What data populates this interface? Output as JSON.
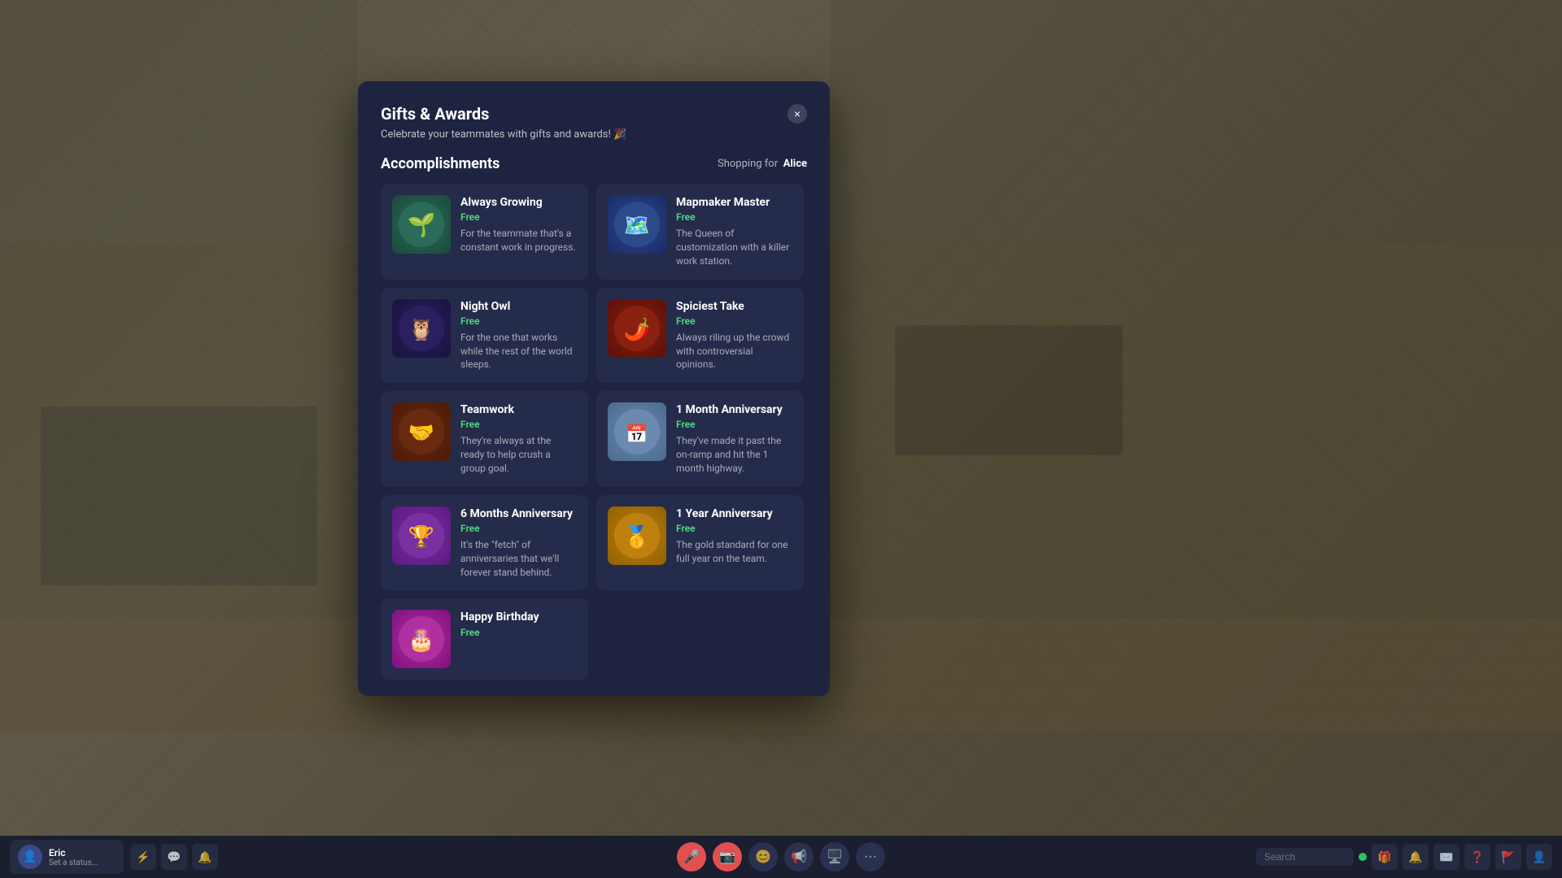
{
  "modal": {
    "title": "Gifts & Awards",
    "subtitle": "Celebrate your teammates with gifts and awards! 🎉",
    "shopping_for_label": "Shopping for",
    "shopping_for_name": "Alice",
    "section_title": "Accomplishments",
    "close_label": "×"
  },
  "awards": [
    {
      "id": "always-growing",
      "name": "Always Growing",
      "price": "Free",
      "description": "For the teammate that's a constant work in progress.",
      "icon_class": "icon-always-growing",
      "icon_emoji": "🌱"
    },
    {
      "id": "mapmaker-master",
      "name": "Mapmaker Master",
      "price": "Free",
      "description": "The Queen of customization with a killer work station.",
      "icon_class": "icon-mapmaker",
      "icon_emoji": "🗺️"
    },
    {
      "id": "night-owl",
      "name": "Night Owl",
      "price": "Free",
      "description": "For the one that works while the rest of the world sleeps.",
      "icon_class": "icon-night-owl",
      "icon_emoji": "🦉"
    },
    {
      "id": "spiciest-take",
      "name": "Spiciest Take",
      "price": "Free",
      "description": "Always riling up the crowd with controversial opinions.",
      "icon_class": "icon-spiciest",
      "icon_emoji": "🌶️"
    },
    {
      "id": "teamwork",
      "name": "Teamwork",
      "price": "Free",
      "description": "They're always at the ready to help crush a group goal.",
      "icon_class": "icon-teamwork",
      "icon_emoji": "🤝"
    },
    {
      "id": "1-month-anniversary",
      "name": "1 Month Anniversary",
      "price": "Free",
      "description": "They've made it past the on-ramp and hit the 1 month highway.",
      "icon_class": "icon-1month",
      "icon_emoji": "📅"
    },
    {
      "id": "6-months-anniversary",
      "name": "6 Months Anniversary",
      "price": "Free",
      "description": "It's the \"fetch\" of anniversaries that we'll forever stand behind.",
      "icon_class": "icon-6months",
      "icon_emoji": "🏆"
    },
    {
      "id": "1-year-anniversary",
      "name": "1 Year Anniversary",
      "price": "Free",
      "description": "The gold standard for one full year on the team.",
      "icon_class": "icon-1year",
      "icon_emoji": "🥇"
    },
    {
      "id": "happy-birthday",
      "name": "Happy Birthday",
      "price": "Free",
      "description": "",
      "icon_class": "icon-birthday",
      "icon_emoji": "🎂"
    }
  ],
  "taskbar": {
    "username": "Eric",
    "status": "Set a status...",
    "search_placeholder": "Search"
  }
}
